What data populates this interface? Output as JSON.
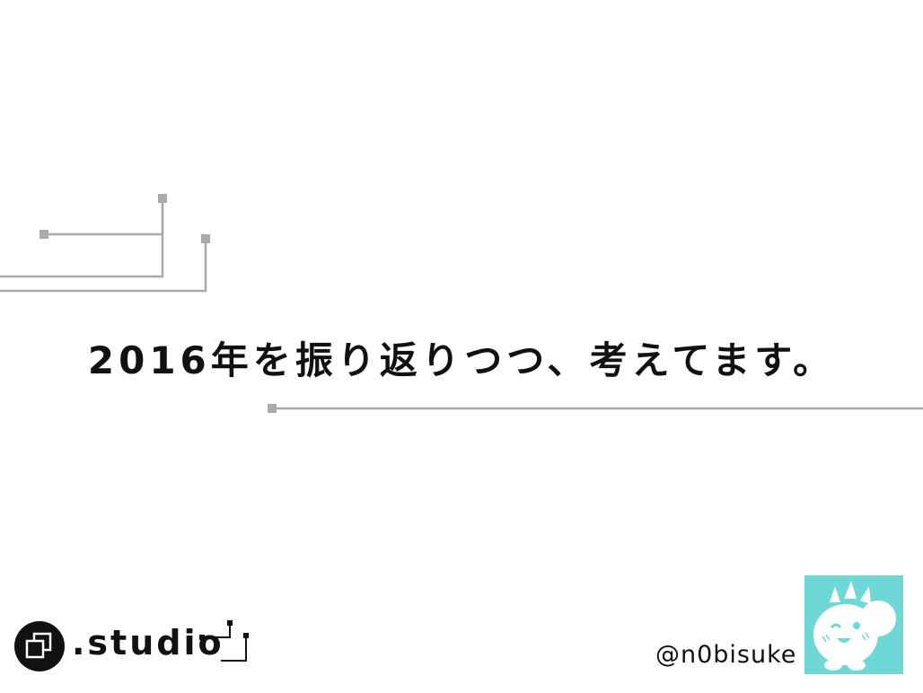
{
  "slide": {
    "title": "2016年を振り返りつつ、考えてます。"
  },
  "logo": {
    "icon": "overlapping-squares-icon",
    "text": ".studio"
  },
  "author": {
    "handle": "@n0bisuke",
    "avatar_icon": "mascot-character-icon"
  },
  "colors": {
    "circuit_lines": "#aaaaaa",
    "avatar_bg": "#6ed8d6",
    "text": "#111111"
  }
}
